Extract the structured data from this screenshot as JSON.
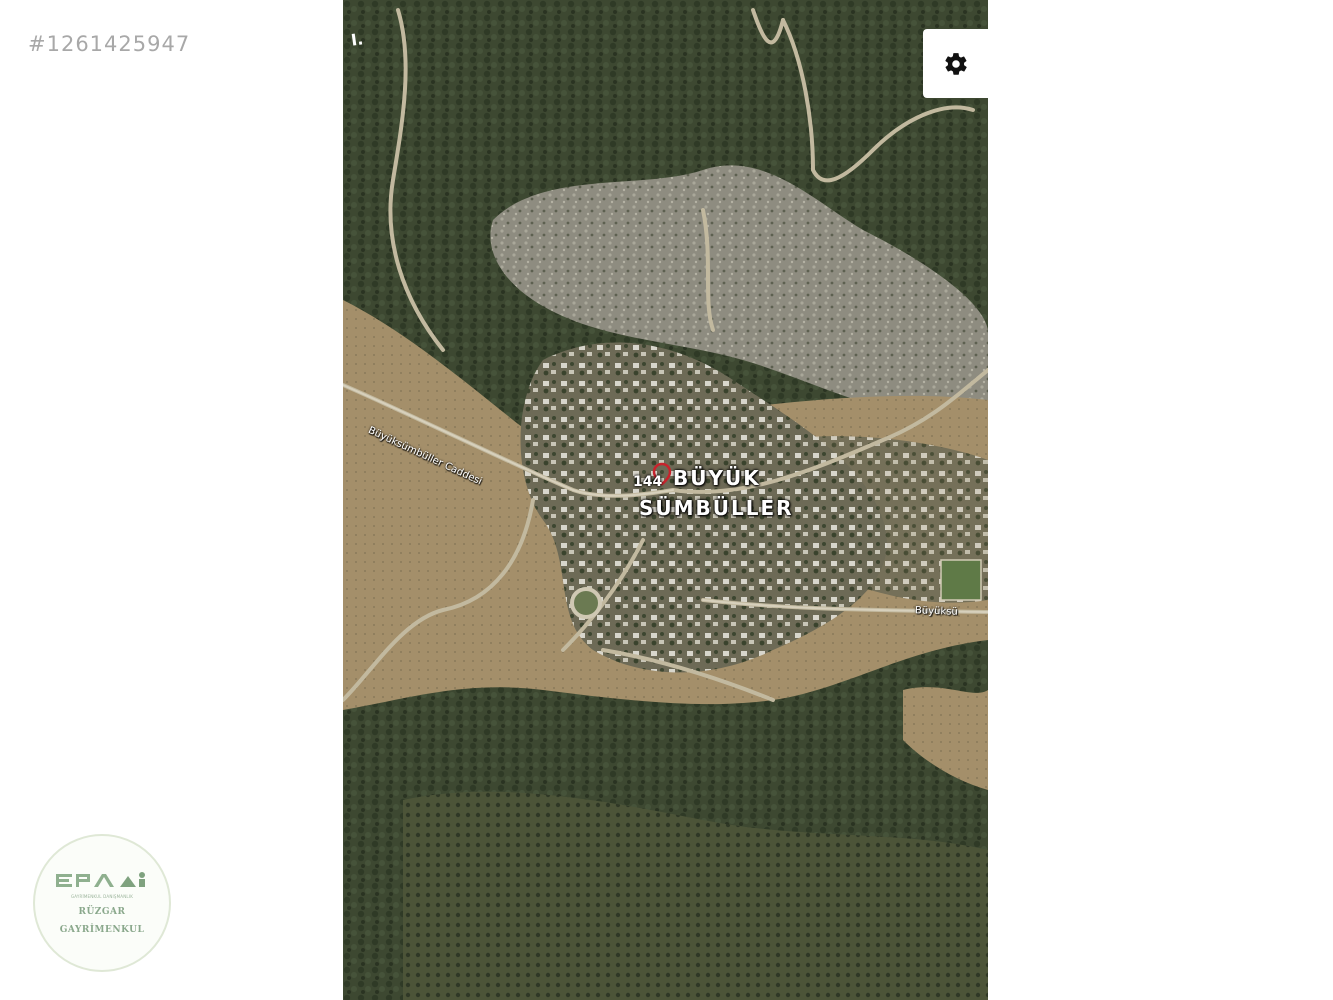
{
  "listing": {
    "id": "#1261425947"
  },
  "map": {
    "type": "satellite",
    "place_label_line1": "BÜYÜK",
    "place_label_line2": "SÜMBÜLLER",
    "marker_number": "144",
    "compass_mark": "I.",
    "road_label_1": "Büyüksümbüller Caddesi",
    "road_label_2": "Büyüksü",
    "settings_icon": "gear-icon"
  },
  "logo": {
    "brand": "EPA",
    "tagline": "GAYRİMENKUL DANIŞMANLIK",
    "line1": "RÜZGAR",
    "line2": "GAYRİMENKUL"
  },
  "colors": {
    "top_bar": "#1c2a3d",
    "top_bar_accent": "#f07a1c",
    "logo_green": "#8aa88c",
    "forest": "#3f4a33",
    "dry_field": "#a89672"
  }
}
